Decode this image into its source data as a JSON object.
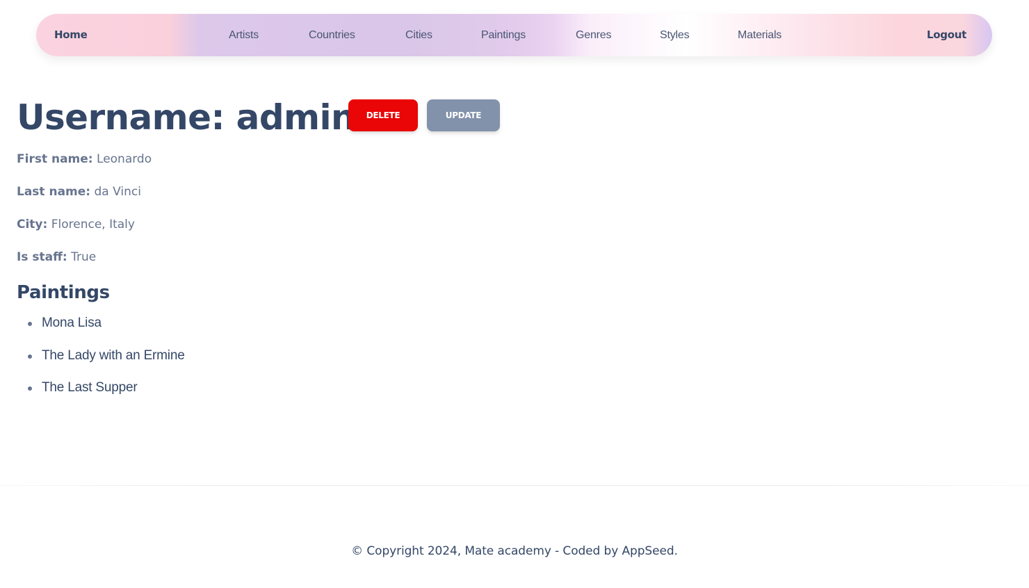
{
  "navbar": {
    "home": "Home",
    "artists": "Artists",
    "countries": "Countries",
    "cities": "Cities",
    "paintings": "Paintings",
    "genres": "Genres",
    "styles": "Styles",
    "materials": "Materials",
    "logout": "Logout"
  },
  "header": {
    "title": "Username: admin",
    "delete_label": "DELETE",
    "update_label": "UPDATE"
  },
  "details": {
    "first_name_label": "First name:",
    "first_name_value": "Leonardo",
    "last_name_label": "Last name:",
    "last_name_value": "da Vinci",
    "city_label": "City:",
    "city_value": "Florence, Italy",
    "is_staff_label": "Is staff:",
    "is_staff_value": "True"
  },
  "paintings": {
    "heading": "Paintings",
    "items": [
      "Mona Lisa",
      "The Lady with an Ermine",
      "The Last Supper"
    ]
  },
  "footer": {
    "copyright": "© Copyright 2024, Mate academy - Coded by AppSeed."
  },
  "colors": {
    "delete_button": "#ea0606",
    "update_button": "#8392ab",
    "heading_text": "#344767",
    "muted_text": "#67748e"
  }
}
